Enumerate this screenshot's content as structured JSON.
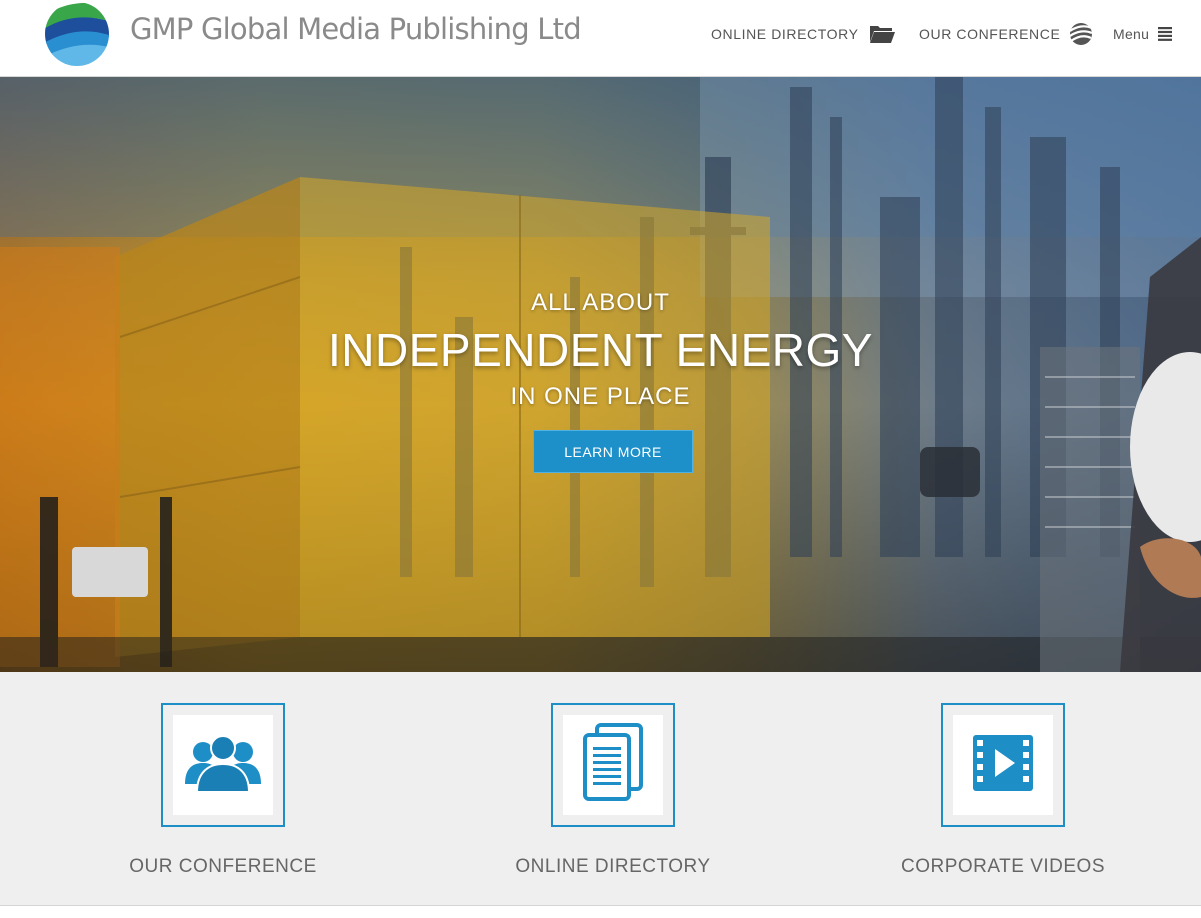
{
  "header": {
    "brand": "GMP Global Media Publishing Ltd",
    "nav": {
      "online_directory": "ONLINE DIRECTORY",
      "our_conference": "OUR CONFERENCE",
      "menu": "Menu"
    }
  },
  "hero": {
    "line1": "ALL ABOUT",
    "line2": "INDEPENDENT ENERGY",
    "line3": "IN ONE PLACE",
    "button": "LEARN MORE"
  },
  "features": [
    {
      "label": "OUR CONFERENCE",
      "icon": "people-group-icon"
    },
    {
      "label": "ONLINE DIRECTORY",
      "icon": "document-list-icon"
    },
    {
      "label": "CORPORATE VIDEOS",
      "icon": "video-film-icon"
    }
  ],
  "colors": {
    "accent": "#1e90c9",
    "text_gray": "#666666",
    "feature_bg": "#efefef"
  }
}
